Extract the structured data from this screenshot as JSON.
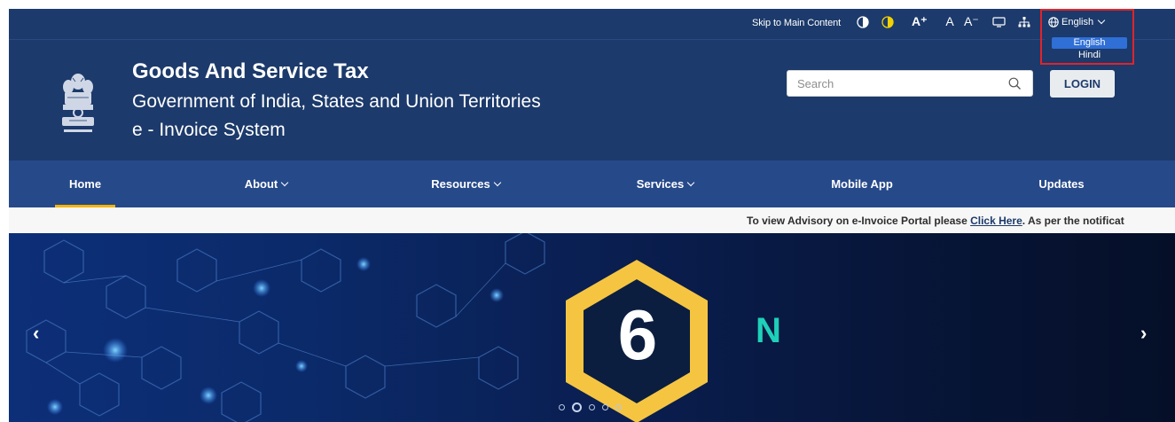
{
  "topbar": {
    "skip_label": "Skip to Main Content",
    "font_increase": "A⁺",
    "font_normal": "A",
    "font_decrease": "A⁻",
    "language_selected": "English"
  },
  "language_menu": {
    "options": [
      "English",
      "Hindi"
    ],
    "selected": "English"
  },
  "header": {
    "title": "Goods And Service Tax",
    "subtitle": "Government of India, States and Union Territories",
    "system": "e - Invoice System",
    "search_placeholder": "Search",
    "login_label": "LOGIN"
  },
  "nav": {
    "items": [
      {
        "label": "Home",
        "active": true
      },
      {
        "label": "About"
      },
      {
        "label": "Resources"
      },
      {
        "label": "Services"
      },
      {
        "label": "Mobile App"
      },
      {
        "label": "Updates"
      }
    ]
  },
  "ticker": {
    "prefix": "To view Advisory on e-Invoice Portal please ",
    "link": "Click Here",
    "suffix": ". As per the notificat"
  },
  "banner": {
    "badge_number": "6",
    "letter": "N",
    "prev_label": "‹",
    "next_label": "›",
    "slide_count": 5,
    "active_slide": 2
  },
  "colors": {
    "header_bg": "#1c3a6b",
    "nav_bg": "#26498a",
    "active_indicator": "#f5b400",
    "highlight": "#e2232a",
    "badge": "#f5c542",
    "teal": "#1fd0b8"
  }
}
